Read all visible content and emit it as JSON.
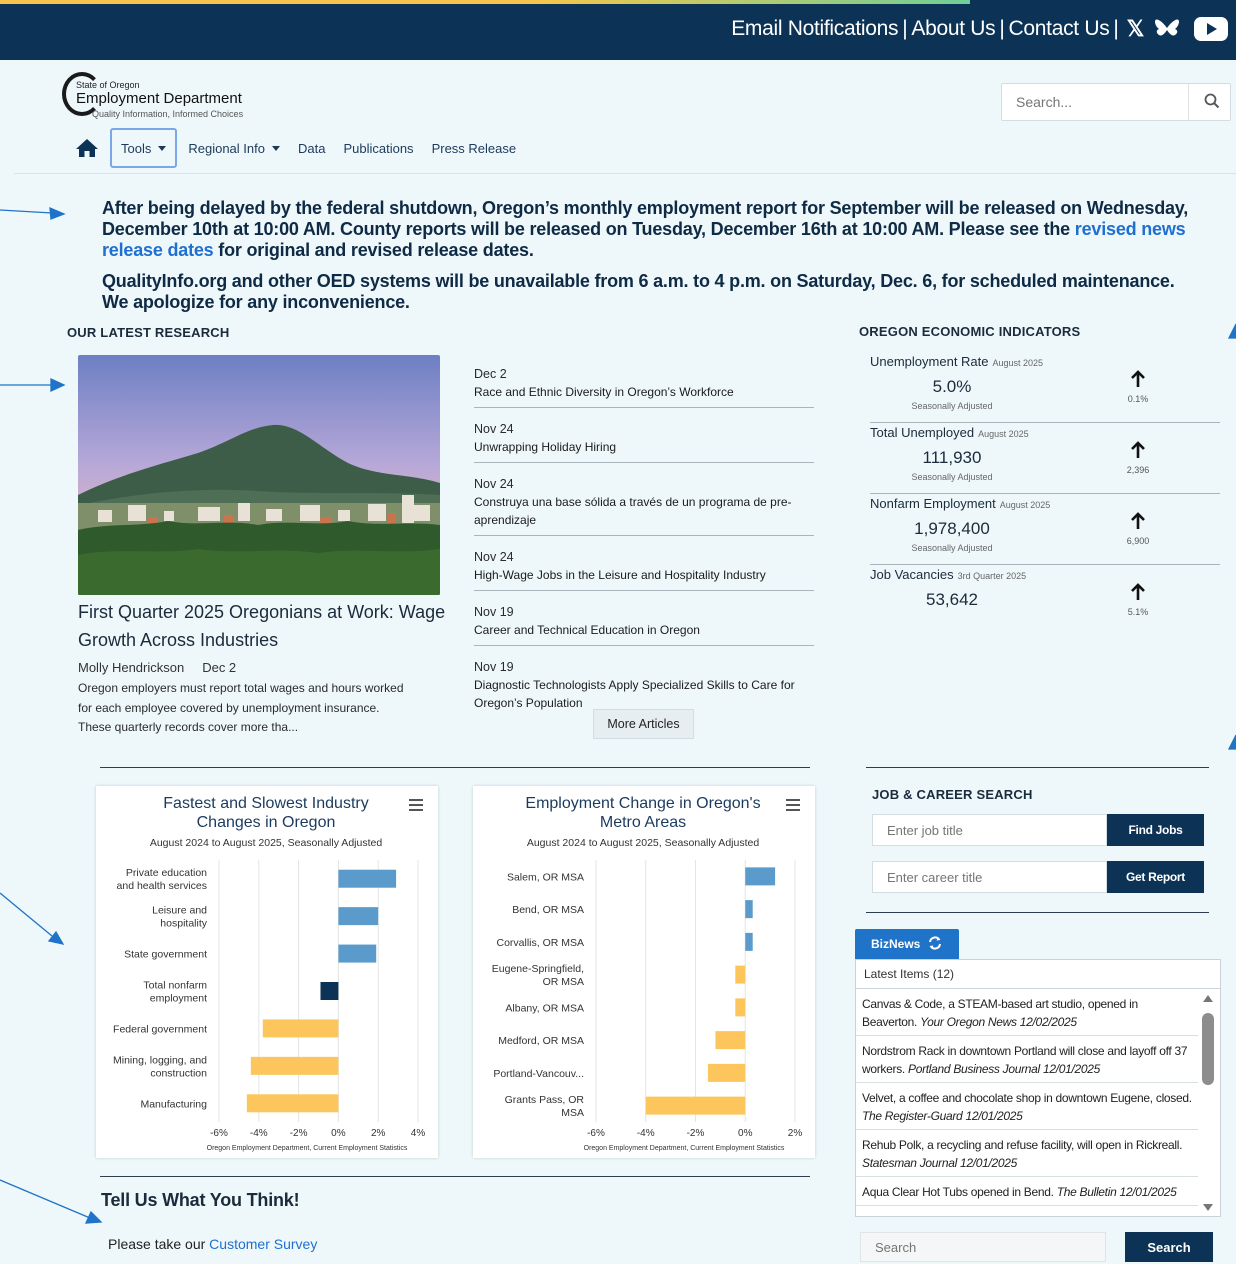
{
  "topbar": {
    "links": [
      "Email Notifications",
      "About Us",
      "Contact Us"
    ],
    "separator": "|",
    "social_icons": [
      "x-icon",
      "bluesky-icon",
      "youtube-icon"
    ],
    "x_glyph": "𝕏"
  },
  "logo": {
    "small": "State of Oregon",
    "main": "Employment Department",
    "tagline": "Quality Information, Informed Choices"
  },
  "search": {
    "placeholder": "Search..."
  },
  "nav": {
    "items": [
      {
        "label": "Tools",
        "dropdown": true,
        "active": true
      },
      {
        "label": "Regional Info",
        "dropdown": true
      },
      {
        "label": "Data"
      },
      {
        "label": "Publications"
      },
      {
        "label": "Press Release"
      }
    ]
  },
  "alerts": {
    "line1_text": "After being delayed by the federal shutdown, Oregon’s monthly employment report for September will be released on Wednesday, December 10th at 10:00 AM. County reports will be released on Tuesday, December 16th at 10:00 AM. Please see the ",
    "line1_link": "revised news release dates",
    "line1_tail": " for original and revised release dates.",
    "line2": "QualityInfo.org and other OED systems will be unavailable from 6 a.m. to 4 p.m. on Saturday, Dec. 6, for scheduled maintenance. We apologize for any inconvenience."
  },
  "research": {
    "title": "OUR LATEST RESEARCH",
    "feature": {
      "title": "First Quarter 2025 Oregonians at Work: Wage Growth Across Industries",
      "author": "Molly Hendrickson",
      "date": "Dec 2",
      "excerpt": "Oregon employers must report total wages and hours worked for each employee covered by unemployment insurance. These quarterly records cover more tha..."
    },
    "articles": [
      {
        "date": "Dec 2",
        "title": "Race and Ethnic Diversity in Oregon’s Workforce"
      },
      {
        "date": "Nov 24",
        "title": "Unwrapping Holiday Hiring"
      },
      {
        "date": "Nov 24",
        "title": "Construya una base sólida a través de un programa de pre-aprendizaje"
      },
      {
        "date": "Nov 24",
        "title": "High-Wage Jobs in the Leisure and Hospitality Industry"
      },
      {
        "date": "Nov 19",
        "title": "Career and Technical Education in Oregon"
      },
      {
        "date": "Nov 19",
        "title": "Diagnostic Technologists Apply Specialized Skills to Care for Oregon’s Population"
      }
    ],
    "more_label": "More Articles"
  },
  "indicators": {
    "title": "OREGON ECONOMIC INDICATORS",
    "items": [
      {
        "name": "Unemployment Rate",
        "period": "August 2025",
        "value": "5.0%",
        "sub": "Seasonally Adjusted",
        "change": "0.1%"
      },
      {
        "name": "Total Unemployed",
        "period": "August 2025",
        "value": "111,930",
        "sub": "Seasonally Adjusted",
        "change": "2,396"
      },
      {
        "name": "Nonfarm Employment",
        "period": "August 2025",
        "value": "1,978,400",
        "sub": "Seasonally Adjusted",
        "change": "6,900"
      },
      {
        "name": "Job Vacancies",
        "period": "3rd Quarter 2025",
        "value": "53,642",
        "sub": "",
        "change": "5.1%"
      }
    ]
  },
  "charts": {
    "colors": {
      "positive": "#5b9bcc",
      "negative": "#fcc65c",
      "total": "#0c3355"
    },
    "industry": {
      "title_lines": [
        "Fastest and Slowest Industry",
        "Changes in Oregon"
      ],
      "subtitle": "August 2024 to August 2025, Seasonally Adjusted",
      "credit": "Oregon Employment Department, Current Employment Statistics",
      "menu_icon": "hamburger-menu-icon"
    },
    "metro": {
      "title_lines": [
        "Employment Change in Oregon's",
        "Metro Areas"
      ],
      "subtitle": "August 2024 to August 2025, Seasonally Adjusted",
      "credit": "Oregon Employment Department, Current Employment Statistics",
      "menu_icon": "hamburger-menu-icon"
    }
  },
  "chart_data": [
    {
      "type": "bar",
      "orientation": "horizontal",
      "categories": [
        "Private education and health services",
        "Leisure and hospitality",
        "State government",
        "Total nonfarm employment",
        "Federal government",
        "Mining, logging, and construction",
        "Manufacturing"
      ],
      "category_lines": [
        [
          "Private education",
          "and health services"
        ],
        [
          "Leisure and",
          "hospitality"
        ],
        [
          "State government"
        ],
        [
          "Total nonfarm",
          "employment"
        ],
        [
          "Federal government"
        ],
        [
          "Mining, logging, and",
          "construction"
        ],
        [
          "Manufacturing"
        ]
      ],
      "values": [
        2.9,
        2.0,
        1.9,
        -0.9,
        -3.8,
        -4.4,
        -4.6
      ],
      "xlim": [
        -6,
        4
      ],
      "xticks": [
        -6,
        -4,
        -2,
        0,
        2,
        4
      ],
      "tick_labels": [
        "-6%",
        "-4%",
        "-2%",
        "0%",
        "2%",
        "4%"
      ],
      "title": "Fastest and Slowest Industry Changes in Oregon",
      "subtitle": "August 2024 to August 2025, Seasonally Adjusted",
      "grid": true
    },
    {
      "type": "bar",
      "orientation": "horizontal",
      "categories": [
        "Salem, OR MSA",
        "Bend, OR MSA",
        "Corvallis, OR MSA",
        "Eugene-Springfield, OR MSA",
        "Albany, OR MSA",
        "Medford, OR MSA",
        "Portland-Vancouv...",
        "Grants Pass, OR MSA"
      ],
      "category_lines": [
        [
          "Salem, OR MSA"
        ],
        [
          "Bend, OR MSA"
        ],
        [
          "Corvallis, OR MSA"
        ],
        [
          "Eugene-Springfield,",
          "OR MSA"
        ],
        [
          "Albany, OR MSA"
        ],
        [
          "Medford, OR MSA"
        ],
        [
          "Portland-Vancouv..."
        ],
        [
          "Grants Pass, OR",
          "MSA"
        ]
      ],
      "values": [
        1.2,
        0.3,
        0.3,
        -0.4,
        -0.4,
        -1.2,
        -1.5,
        -4.0
      ],
      "xlim": [
        -6,
        2
      ],
      "xticks": [
        -6,
        -4,
        -2,
        0,
        2
      ],
      "tick_labels": [
        "-6%",
        "-4%",
        "-2%",
        "0%",
        "2%"
      ],
      "title": "Employment Change in Oregon's Metro Areas",
      "subtitle": "August 2024 to August 2025, Seasonally Adjusted",
      "grid": true
    }
  ],
  "jobsearch": {
    "title": "JOB & CAREER SEARCH",
    "job_placeholder": "Enter job title",
    "job_button": "Find Jobs",
    "career_placeholder": "Enter career title",
    "career_button": "Get Report"
  },
  "biznews": {
    "tab_label": "BizNews",
    "header": "Latest Items (12)",
    "items": [
      {
        "text": "Canvas & Code, a STEAM-based art studio, opened in Beaverton.",
        "source": "Your Oregon News 12/02/2025"
      },
      {
        "text": "Nordstrom Rack in downtown Portland will close and layoff off 37 workers.",
        "source": "Portland Business Journal 12/01/2025"
      },
      {
        "text": "Velvet, a coffee and chocolate shop in downtown Eugene, closed.",
        "source": "The Register-Guard 12/01/2025"
      },
      {
        "text": "Rehub Polk, a recycling and refuse facility, will open in Rickreall.",
        "source": "Statesman Journal 12/01/2025"
      },
      {
        "text": "Aqua Clear Hot Tubs opened in Bend.",
        "source": "The Bulletin 12/01/2025"
      }
    ],
    "search_placeholder": "Search",
    "search_button": "Search"
  },
  "feedback": {
    "title": "Tell Us What You Think!",
    "text": "Please take our ",
    "link": "Customer Survey"
  },
  "annotation_color": "#1f73c8"
}
